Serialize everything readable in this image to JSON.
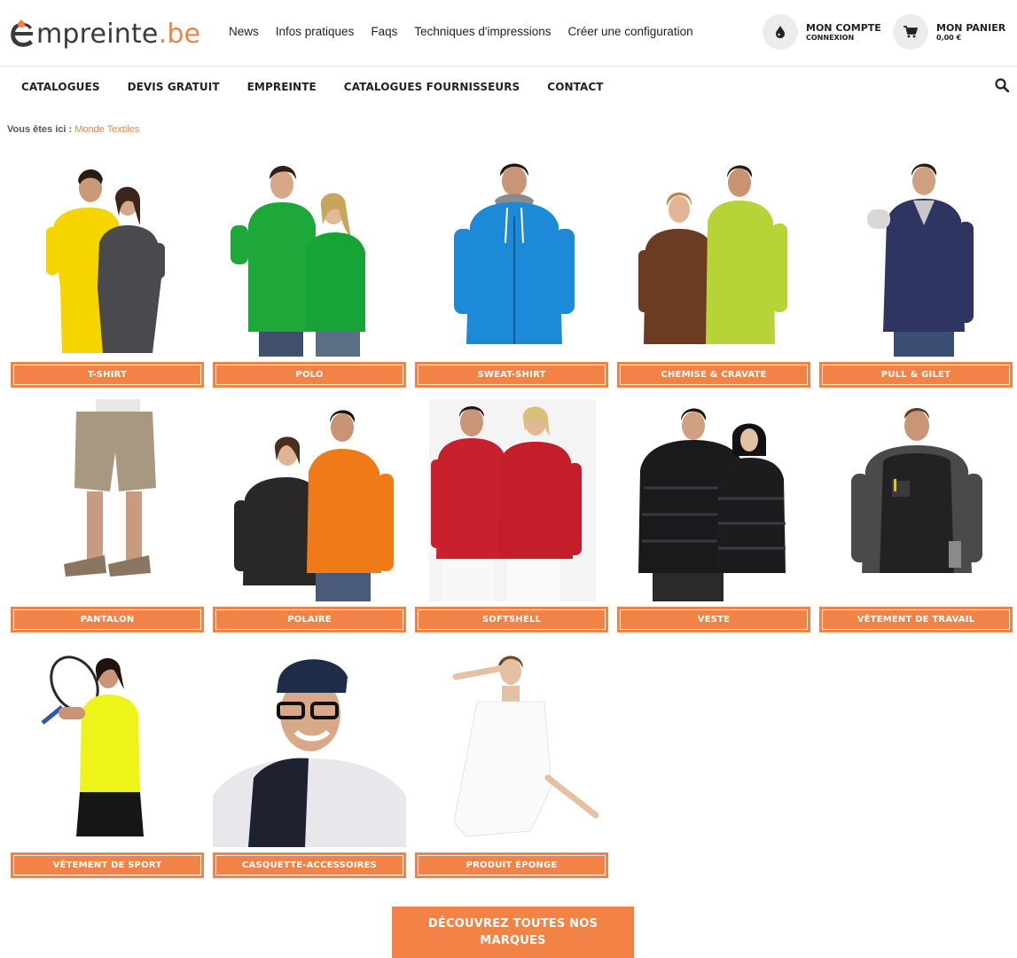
{
  "header": {
    "logo": {
      "letter": "E",
      "rest": "mpreinte",
      "tld": ".be"
    },
    "top_links": [
      "News",
      "Infos pratiques",
      "Faqs",
      "Techniques d'impressions",
      "Créer une configuration"
    ],
    "account": {
      "title": "MON COMPTE",
      "subtitle": "CONNEXION",
      "icon": "drop-icon"
    },
    "cart": {
      "title": "MON PANIER",
      "amount": "0,00 €",
      "icon": "cart-icon"
    }
  },
  "main_nav": {
    "items": [
      "CATALOGUES",
      "DEVIS GRATUIT",
      "EMPREINTE",
      "CATALOGUES FOURNISSEURS",
      "CONTACT"
    ],
    "search_icon": "search-icon"
  },
  "breadcrumb": {
    "label": "Vous êtes ici :",
    "current": "Monde Textiles"
  },
  "categories": [
    {
      "label": "T-SHIRT"
    },
    {
      "label": "POLO"
    },
    {
      "label": "SWEAT-SHIRT"
    },
    {
      "label": "CHEMISE & CRAVATE"
    },
    {
      "label": "PULL & GILET"
    },
    {
      "label": "PANTALON"
    },
    {
      "label": "POLAIRE"
    },
    {
      "label": "SOFTSHELL"
    },
    {
      "label": "VESTE"
    },
    {
      "label": "VÊTEMENT DE TRAVAIL"
    },
    {
      "label": "VÊTEMENT DE SPORT"
    },
    {
      "label": "CASQUETTE-ACCESSOIRES"
    },
    {
      "label": "PRODUIT ÉPONGE"
    }
  ],
  "cta": {
    "label": "DÉCOUVREZ TOUTES NOS MARQUES"
  },
  "colors": {
    "accent": "#f28245",
    "text": "#222222",
    "icon_bg": "#ececec"
  }
}
